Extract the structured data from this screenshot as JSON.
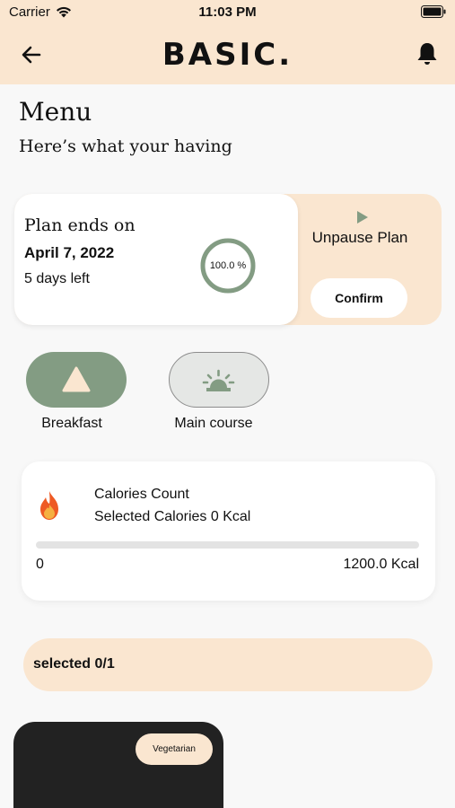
{
  "status_bar": {
    "carrier": "Carrier",
    "time": "11:03 PM"
  },
  "header": {
    "brand": "BASIC.",
    "back_icon": "arrow-left-icon",
    "notification_icon": "bell-icon"
  },
  "page": {
    "title": "Menu",
    "subtitle": "Here’s what your having"
  },
  "plan": {
    "label": "Plan ends on",
    "end_date": "April 7, 2022",
    "days_left": "5 days left",
    "progress_label": "100.0 %",
    "progress_fraction": 1.0,
    "action_icon": "play-icon",
    "action_label": "Unpause Plan",
    "confirm_label": "Confirm"
  },
  "categories": [
    {
      "label": "Breakfast",
      "icon": "breakfast-icon",
      "selected": true
    },
    {
      "label": "Main course",
      "icon": "sunrise-icon",
      "selected": false
    }
  ],
  "calories": {
    "title": "Calories Count",
    "selected_text": "Selected Calories 0 Kcal",
    "min_label": "0",
    "max_label": "1200.0 Kcal",
    "progress_fraction": 0,
    "icon": "flame-icon"
  },
  "selection": {
    "text": "selected 0/1"
  },
  "food_card": {
    "tag": "Vegetarian"
  },
  "colors": {
    "accent": "#839c83",
    "header_bg": "#fae6d0",
    "background": "#f8f8f8"
  }
}
